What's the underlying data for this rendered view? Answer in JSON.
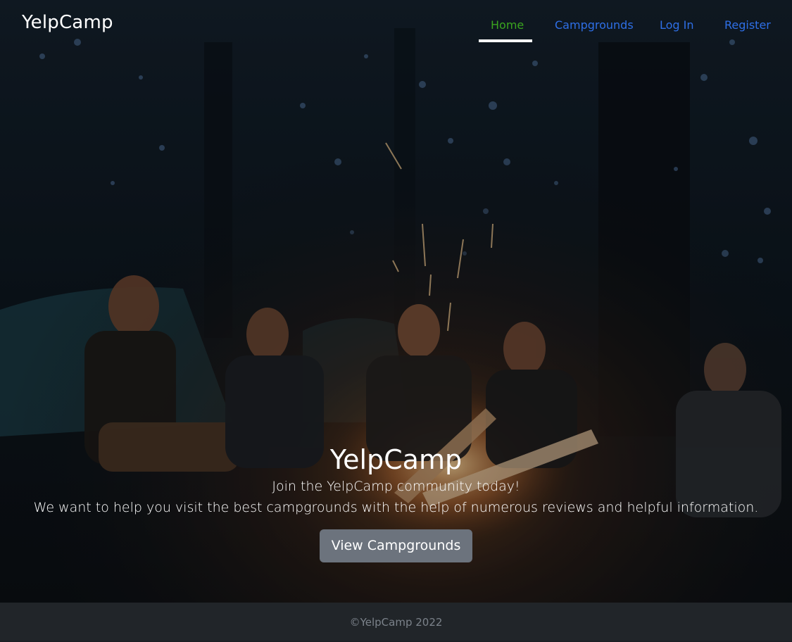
{
  "navbar": {
    "brand": "YelpCamp",
    "links": [
      {
        "label": "Home",
        "active": true
      },
      {
        "label": "Campgrounds",
        "active": false
      },
      {
        "label": "Log In",
        "active": false
      },
      {
        "label": "Register",
        "active": false
      }
    ]
  },
  "hero": {
    "title": "YelpCamp",
    "tagline": "Join the YelpCamp community today!",
    "description": "We want to help you visit the best campgrounds with the help of numerous reviews and helpful information.",
    "cta_label": "View Campgrounds"
  },
  "footer": {
    "copyright": "©YelpCamp 2022"
  },
  "colors": {
    "link": "#2e6fe6",
    "active_link": "#3aa51f",
    "button": "#6c737d",
    "footer_bg": "#212529",
    "footer_text": "#7b828a"
  }
}
